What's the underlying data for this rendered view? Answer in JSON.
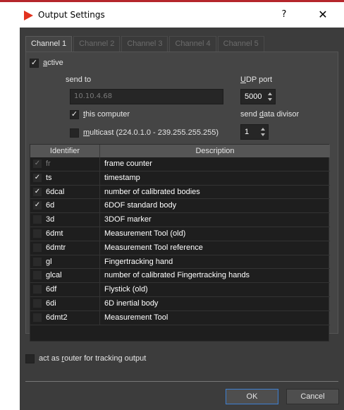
{
  "window": {
    "title": "Output Settings",
    "help_symbol": "?",
    "close_symbol": "✕",
    "app_icon": "red-play-triangle-icon"
  },
  "colors": {
    "accent": "#b5262c",
    "app_icon": "#e2321f",
    "dialog_bg": "#3c3c3c",
    "panel_bg": "#454545",
    "ok_border": "#3d7fd1"
  },
  "tabs": [
    {
      "label": "Channel 1",
      "active": true
    },
    {
      "label": "Channel 2",
      "active": false
    },
    {
      "label": "Channel 3",
      "active": false
    },
    {
      "label": "Channel 4",
      "active": false
    },
    {
      "label": "Channel 5",
      "active": false
    }
  ],
  "channel": {
    "active_label_prefix": "",
    "active_label_u": "a",
    "active_label_rest": "ctive",
    "active_checked": true,
    "send_to_label": "send to",
    "send_to_value": "10.10.4.68",
    "udp_label_u": "U",
    "udp_label_rest": "DP port",
    "udp_value": "5000",
    "this_computer_u": "t",
    "this_computer_rest": "his computer",
    "this_computer_checked": true,
    "multicast_u": "m",
    "multicast_rest": "ulticast (224.0.1.0 - 239.255.255.255)",
    "multicast_checked": false,
    "divisor_label_pre": "send ",
    "divisor_label_u": "d",
    "divisor_label_rest": "ata divisor",
    "divisor_value": "1"
  },
  "table": {
    "headers": [
      "Identifier",
      "Description"
    ],
    "rows": [
      {
        "id": "fr",
        "description": "frame counter",
        "checked": true,
        "disabled": true
      },
      {
        "id": "ts",
        "description": "timestamp",
        "checked": true,
        "disabled": false
      },
      {
        "id": "6dcal",
        "description": "number of calibrated bodies",
        "checked": true,
        "disabled": false
      },
      {
        "id": "6d",
        "description": "6DOF standard body",
        "checked": true,
        "disabled": false
      },
      {
        "id": "3d",
        "description": "3DOF marker",
        "checked": false,
        "disabled": false
      },
      {
        "id": "6dmt",
        "description": "Measurement Tool (old)",
        "checked": false,
        "disabled": false
      },
      {
        "id": "6dmtr",
        "description": "Measurement Tool reference",
        "checked": false,
        "disabled": false
      },
      {
        "id": "gl",
        "description": "Fingertracking hand",
        "checked": false,
        "disabled": false
      },
      {
        "id": "glcal",
        "description": "number of calibrated Fingertracking hands",
        "checked": false,
        "disabled": false
      },
      {
        "id": "6df",
        "description": "Flystick (old)",
        "checked": false,
        "disabled": false
      },
      {
        "id": "6di",
        "description": "6D inertial body",
        "checked": false,
        "disabled": false
      },
      {
        "id": "6dmt2",
        "description": "Measurement Tool",
        "checked": false,
        "disabled": false
      }
    ]
  },
  "router": {
    "label_pre": "act as ",
    "label_u": "r",
    "label_rest": "outer for tracking output",
    "checked": false
  },
  "buttons": {
    "ok": "OK",
    "cancel": "Cancel"
  }
}
